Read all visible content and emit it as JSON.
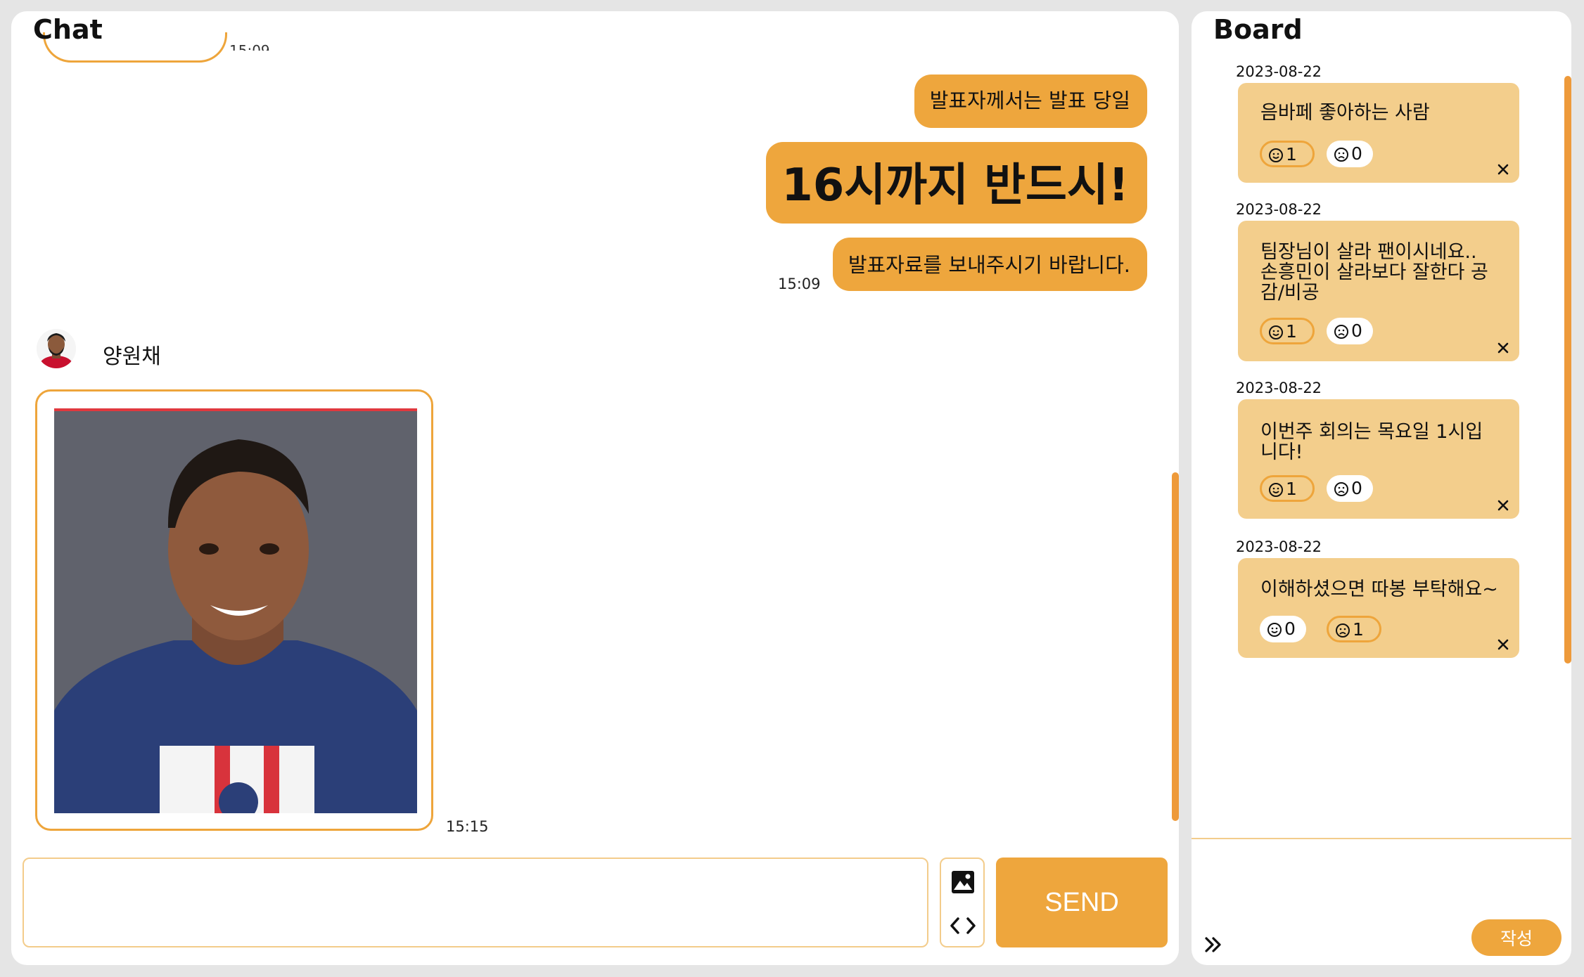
{
  "chat": {
    "title": "Chat",
    "prev_time": "15:09",
    "messages": [
      {
        "text": "발표자께서는 발표 당일"
      },
      {
        "text": "16시까지 반드시!"
      },
      {
        "text": "발표자료를 보내주시기 바랍니다.",
        "time": "15:09"
      }
    ],
    "image_message": {
      "sender": "양원채",
      "time": "15:15"
    },
    "input": {
      "value": "",
      "placeholder": ""
    },
    "send_label": "SEND"
  },
  "board": {
    "title": "Board",
    "write_label": "작성",
    "posts": [
      {
        "date": "2023-08-22",
        "text": "음바페 좋아하는 사람",
        "like": "1",
        "dislike": "0"
      },
      {
        "date": "2023-08-22",
        "text": "팀장님이 살라 팬이시네요.. 손흥민이 살라보다 잘한다 공감/비공",
        "like": "1",
        "dislike": "0"
      },
      {
        "date": "2023-08-22",
        "text": "이번주 회의는 목요일 1시입니다!",
        "like": "1",
        "dislike": "0"
      },
      {
        "date": "2023-08-22",
        "text": "이해하셨으면 따봉 부탁해요~",
        "like": "0",
        "dislike": "1"
      }
    ]
  },
  "colors": {
    "accent": "#eea63d",
    "note_bg": "#f3ce8c",
    "border_light": "#f3cc8b"
  },
  "icons": [
    "smile-icon",
    "frown-icon",
    "close-icon",
    "image-icon",
    "code-icon",
    "expand-icon"
  ]
}
